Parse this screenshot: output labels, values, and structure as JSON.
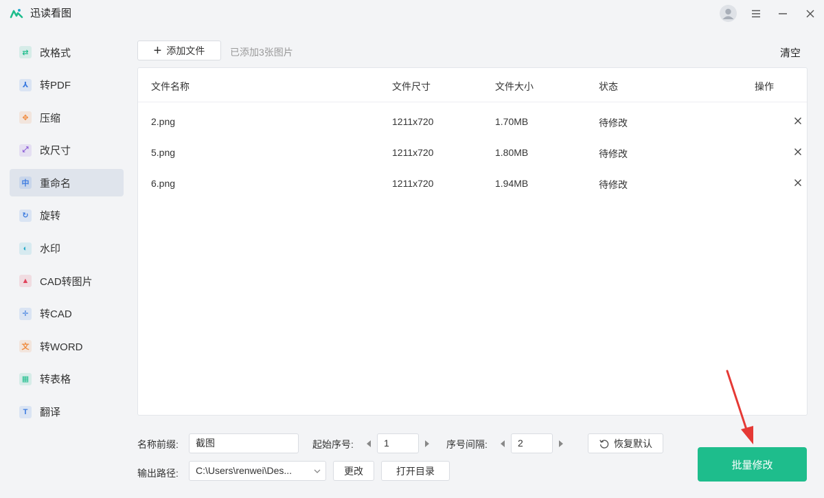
{
  "app": {
    "title": "迅读看图"
  },
  "colors": {
    "accent": "#1ebd8c",
    "arrow": "#e53935"
  },
  "sidebar": {
    "items": [
      {
        "label": "改格式",
        "icon": "convert-format-icon",
        "color": "#1ebd8c",
        "glyph": "⇄",
        "active": false
      },
      {
        "label": "转PDF",
        "icon": "pdf-icon",
        "color": "#3d7ce0",
        "glyph": "⅄",
        "active": false
      },
      {
        "label": "压缩",
        "icon": "compress-icon",
        "color": "#f08a3c",
        "glyph": "✥",
        "active": false
      },
      {
        "label": "改尺寸",
        "icon": "resize-icon",
        "color": "#8b5cd6",
        "glyph": "⤢",
        "active": false
      },
      {
        "label": "重命名",
        "icon": "rename-icon",
        "color": "#3d7ce0",
        "glyph": "中",
        "active": true
      },
      {
        "label": "旋转",
        "icon": "rotate-icon",
        "color": "#3d7ce0",
        "glyph": "↻",
        "active": false
      },
      {
        "label": "水印",
        "icon": "watermark-icon",
        "color": "#25a9c9",
        "glyph": "◐",
        "active": false
      },
      {
        "label": "CAD转图片",
        "icon": "cad-to-image-icon",
        "color": "#e0445c",
        "glyph": "▲",
        "active": false
      },
      {
        "label": "转CAD",
        "icon": "to-cad-icon",
        "color": "#3d7ce0",
        "glyph": "✛",
        "active": false
      },
      {
        "label": "转WORD",
        "icon": "translate-word-icon",
        "color": "#f08a3c",
        "glyph": "文",
        "active": false
      },
      {
        "label": "转表格",
        "icon": "table-icon",
        "color": "#1ebd8c",
        "glyph": "▦",
        "active": false
      },
      {
        "label": "翻译",
        "icon": "translate-icon",
        "color": "#3d7ce0",
        "glyph": "T",
        "active": false
      }
    ]
  },
  "toolbar": {
    "add_label": "添加文件",
    "added_text": "已添加3张图片",
    "clear_label": "清空"
  },
  "table": {
    "headers": {
      "name": "文件名称",
      "dims": "文件尺寸",
      "size": "文件大小",
      "status": "状态",
      "action": "操作"
    },
    "rows": [
      {
        "name": "2.png",
        "dims": "1211x720",
        "size": "1.70MB",
        "status": "待修改"
      },
      {
        "name": "5.png",
        "dims": "1211x720",
        "size": "1.80MB",
        "status": "待修改"
      },
      {
        "name": "6.png",
        "dims": "1211x720",
        "size": "1.94MB",
        "status": "待修改"
      }
    ]
  },
  "settings": {
    "prefix_label": "名称前缀:",
    "prefix_value": "截图",
    "start_label": "起始序号:",
    "start_value": "1",
    "step_label": "序号间隔:",
    "step_value": "2",
    "reset_label": "恢复默认",
    "output_label": "输出路径:",
    "output_value": "C:\\Users\\renwei\\Des...",
    "change_label": "更改",
    "open_dir_label": "打开目录"
  },
  "primary_action": {
    "label": "批量修改"
  }
}
